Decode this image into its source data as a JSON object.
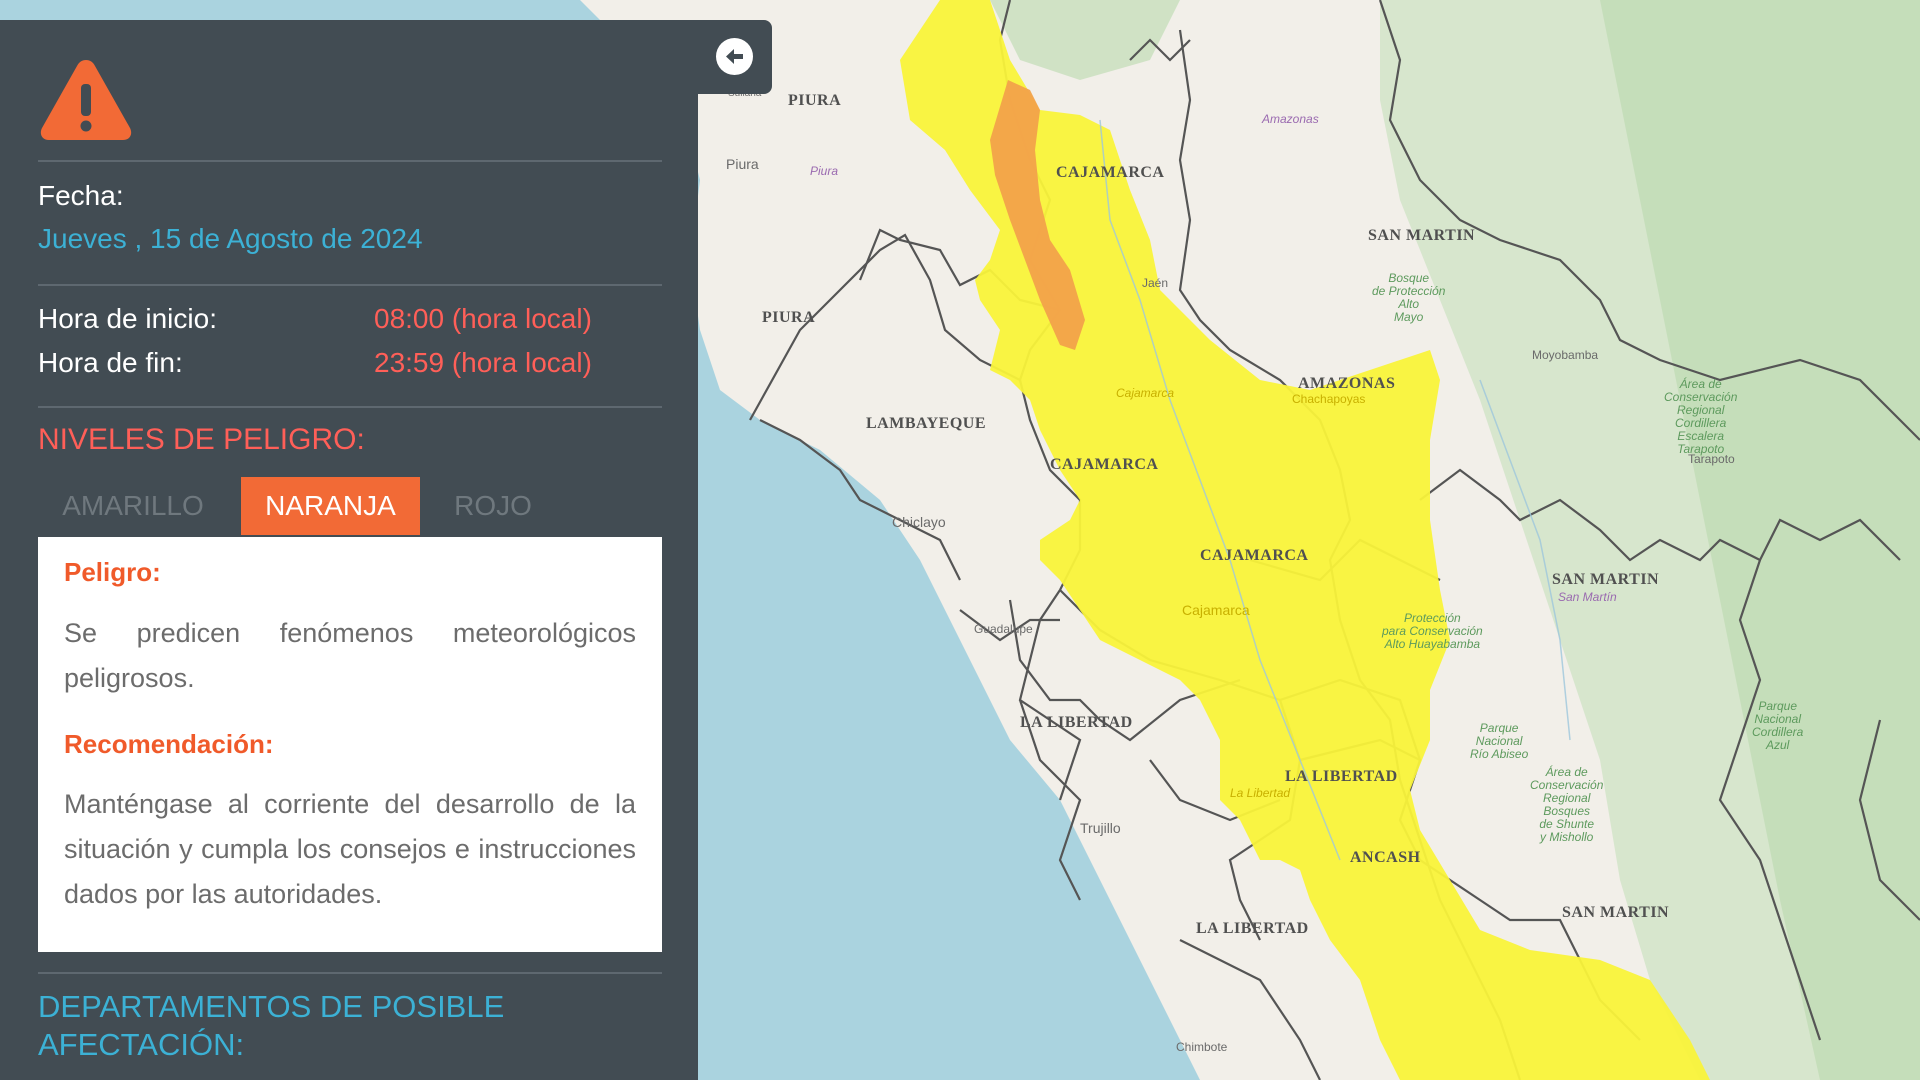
{
  "colors": {
    "panel_bg": "#424c53",
    "accent_blue": "#3cb1d5",
    "time_red": "#ff5f58",
    "tab_orange": "#f26a36",
    "warning_orange": "#f26a36",
    "alert_yellow": "#f9f33a",
    "alert_orange": "#f2a24a",
    "sea": "#aad3df",
    "land": "#f2efe9"
  },
  "panel": {
    "icon": "warning-triangle-icon",
    "fecha_label": "Fecha:",
    "fecha_value": "Jueves , 15 de Agosto de 2024",
    "inicio_label": "Hora de inicio:",
    "inicio_value": "08:00 (hora local)",
    "fin_label": "Hora de fin:",
    "fin_value": "23:59 (hora local)",
    "niveles_title": "NIVELES DE PELIGRO:",
    "tabs": [
      {
        "label": "AMARILLO",
        "active": false
      },
      {
        "label": "NARANJA",
        "active": true
      },
      {
        "label": "ROJO",
        "active": false
      }
    ],
    "peligro_label": "Peligro:",
    "peligro_text": "Se predicen fenómenos meteorológicos peligrosos.",
    "recomendacion_label": "Recomendación:",
    "recomendacion_text": "Manténgase al corriente del desarrollo de la situación y cumpla los consejos e instrucciones dados por las autoridades.",
    "departamentos_title": "DEPARTAMENTOS DE POSIBLE AFECTACIÓN:"
  },
  "collapse_button": {
    "icon": "arrow-left-icon"
  },
  "map": {
    "region_labels": [
      "PIURA",
      "PIURA",
      "CAJAMARCA",
      "SAN MARTIN",
      "AMAZONAS",
      "LAMBAYEQUE",
      "CAJAMARCA",
      "CAJAMARCA",
      "SAN MARTIN",
      "LA LIBERTAD",
      "LA LIBERTAD",
      "ANCASH",
      "LA LIBERTAD",
      "SAN MARTIN",
      "AMAZONAS"
    ],
    "city_labels": [
      "Piura",
      "Chiclayo",
      "Guadalupe",
      "Trujillo",
      "Chimbote",
      "Moyobamba",
      "Tarapoto",
      "Jaén",
      "Chachapoyas",
      "Cajamarca",
      "San Martín",
      "La Libertad",
      "Piura",
      "Cajamarca",
      "Amazonas",
      "Sullana"
    ],
    "park_labels": [
      "Bosque\nde Protección\nAlto\nMayo",
      "Área de\nConservación\nRegional\nCordillera\nEscalera\nTarapoto",
      "Protección\npara Conservación\nAlto Huayabamba",
      "Parque\nNacional\nRío Abiseo",
      "Área de\nConservación\nRegional\nBosques\nde Shunte\ny Mishollo",
      "Parque\nNacional\nCordillera\nAzul"
    ]
  }
}
